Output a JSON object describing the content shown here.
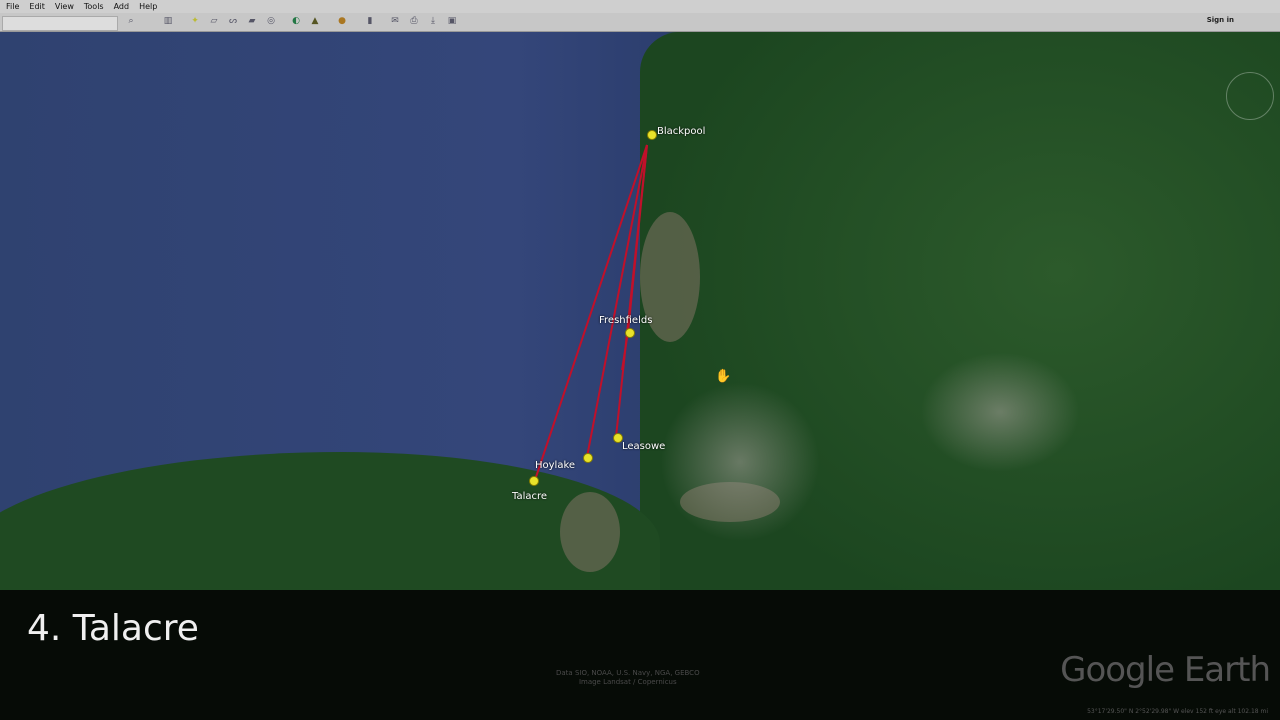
{
  "menu": [
    "File",
    "Edit",
    "View",
    "Tools",
    "Add",
    "Help"
  ],
  "toolbar": {
    "sign_in": "Sign in",
    "search_placeholder": ""
  },
  "placemarks": [
    "Blackpool",
    "Freshfields",
    "Leasowe",
    "Hoylake",
    "Talacre"
  ],
  "caption": "4. Talacre",
  "attribution": [
    "Data SIO, NOAA, U.S. Navy, NGA, GEBCO",
    "Image Landsat / Copernicus"
  ],
  "logo": "Google Earth",
  "status": "53°17'29.50\" N   2°52'29.98\" W   elev 152 ft   eye alt 102.18 mi",
  "colors": {
    "route": "#c0102a",
    "pin": "#e8e22a",
    "water": "#2f4270"
  }
}
